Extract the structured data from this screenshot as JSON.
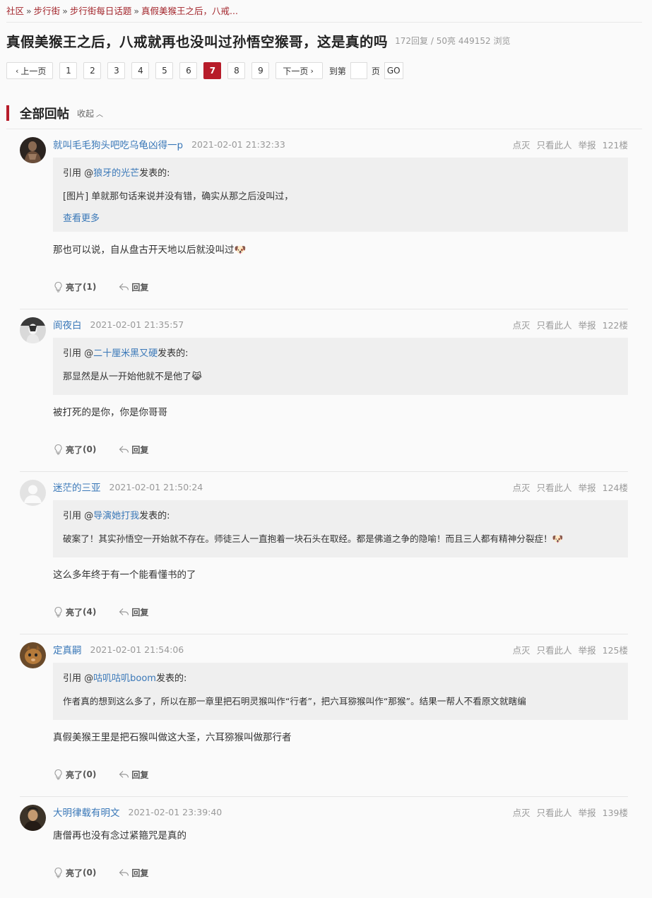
{
  "breadcrumb": {
    "items": [
      "社区",
      "步行街",
      "步行街每日话题",
      "真假美猴王之后，八戒..."
    ],
    "separator": "»"
  },
  "thread": {
    "title": "真假美猴王之后，八戒就再也没叫过孙悟空猴哥，这是真的吗",
    "meta": "172回复 / 50亮 449152 浏览"
  },
  "pager": {
    "prev_label": "上一页",
    "next_label": "下一页",
    "pages": [
      "1",
      "2",
      "3",
      "4",
      "5",
      "6",
      "7",
      "8",
      "9"
    ],
    "active_page": "7",
    "goto_label": "到第",
    "goto_suffix": "页",
    "go_label": "GO"
  },
  "section": {
    "title": "全部回帖",
    "collapse_label": "收起"
  },
  "actions": {
    "dislike": "点灭",
    "only_this": "只看此人",
    "report": "举报"
  },
  "footer": {
    "light_label": "亮了",
    "reply_label": "回复"
  },
  "quote_common": {
    "prefix": "引用 @",
    "suffix": " 发表的:",
    "more": "查看更多"
  },
  "posts": [
    {
      "user": "就叫毛毛狗头吧吃乌龟凶得一p",
      "time": "2021-02-01 21:32:33",
      "floor": "121楼",
      "quote_user": "狼牙的光芒",
      "quote_text": "[图片] 单就那句话来说并没有错，确实从那之后没叫过，",
      "quote_more": true,
      "body": "那也可以说，自从盘古开天地以后就没叫过🐶",
      "light_count": "(1)"
    },
    {
      "user": "阆夜白",
      "time": "2021-02-01 21:35:57",
      "floor": "122楼",
      "quote_user": "二十厘米黑又硬",
      "quote_text": "那显然是从一开始他就不是他了😹",
      "quote_more": false,
      "body": "被打死的是你，你是你哥哥",
      "light_count": "(0)"
    },
    {
      "user": "迷茫的三亚",
      "time": "2021-02-01 21:50:24",
      "floor": "124楼",
      "quote_user": "导演她打我",
      "quote_text": "破案了！其实孙悟空一开始就不存在。师徒三人一直抱着一块石头在取经。都是佛道之争的隐喻！而且三人都有精神分裂症！🐶",
      "quote_more": false,
      "body": "这么多年终于有一个能看懂书的了",
      "light_count": "(4)"
    },
    {
      "user": "定真嗣",
      "time": "2021-02-01 21:54:06",
      "floor": "125楼",
      "quote_user": "咕叽咕叽boom",
      "quote_text": "作者真的想到这么多了，所以在那一章里把石明灵猴叫作“行者”，把六耳猕猴叫作“那猴”。结果一帮人不看原文就瞎编",
      "quote_more": false,
      "body": "真假美猴王里是把石猴叫做这大圣，六耳猕猴叫做那行者",
      "light_count": "(0)"
    },
    {
      "user": "大明律载有明文",
      "time": "2021-02-01 23:39:40",
      "floor": "139楼",
      "body": "唐僧再也没有念过紧箍咒是真的",
      "light_count": "(0)"
    }
  ]
}
